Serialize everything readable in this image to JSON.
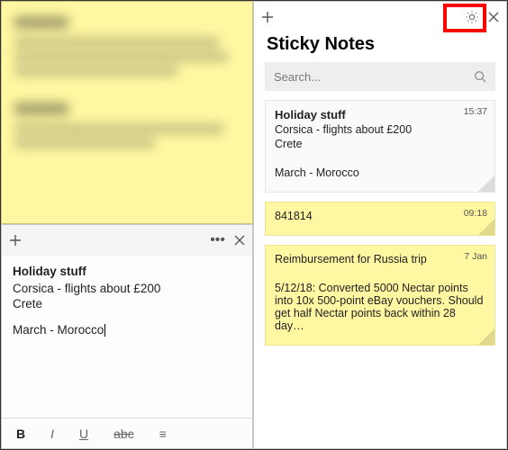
{
  "left_blurred_note": {},
  "white_note": {
    "title": "Holiday stuff",
    "line1": "Corsica - flights about £200",
    "line2": "Crete",
    "line3": "March - Morocco",
    "toolbar": {
      "bold": "B",
      "italic": "I",
      "underline": "U",
      "strike": "abc",
      "list": "≡"
    }
  },
  "app": {
    "title": "Sticky Notes",
    "search_placeholder": "Search..."
  },
  "notes": [
    {
      "color": "white",
      "time": "15:37",
      "title": "Holiday stuff",
      "lines": [
        "Corsica - flights about £200",
        "Crete",
        "",
        "March - Morocco"
      ]
    },
    {
      "color": "yellow",
      "time": "09:18",
      "lines": [
        "841814"
      ]
    },
    {
      "color": "yellow",
      "time": "7 Jan",
      "lines": [
        "Reimbursement for Russia trip",
        "",
        "5/12/18: Converted 5000 Nectar points into 10x 500-point eBay vouchers. Should get half Nectar points back within 28 day…"
      ]
    }
  ]
}
